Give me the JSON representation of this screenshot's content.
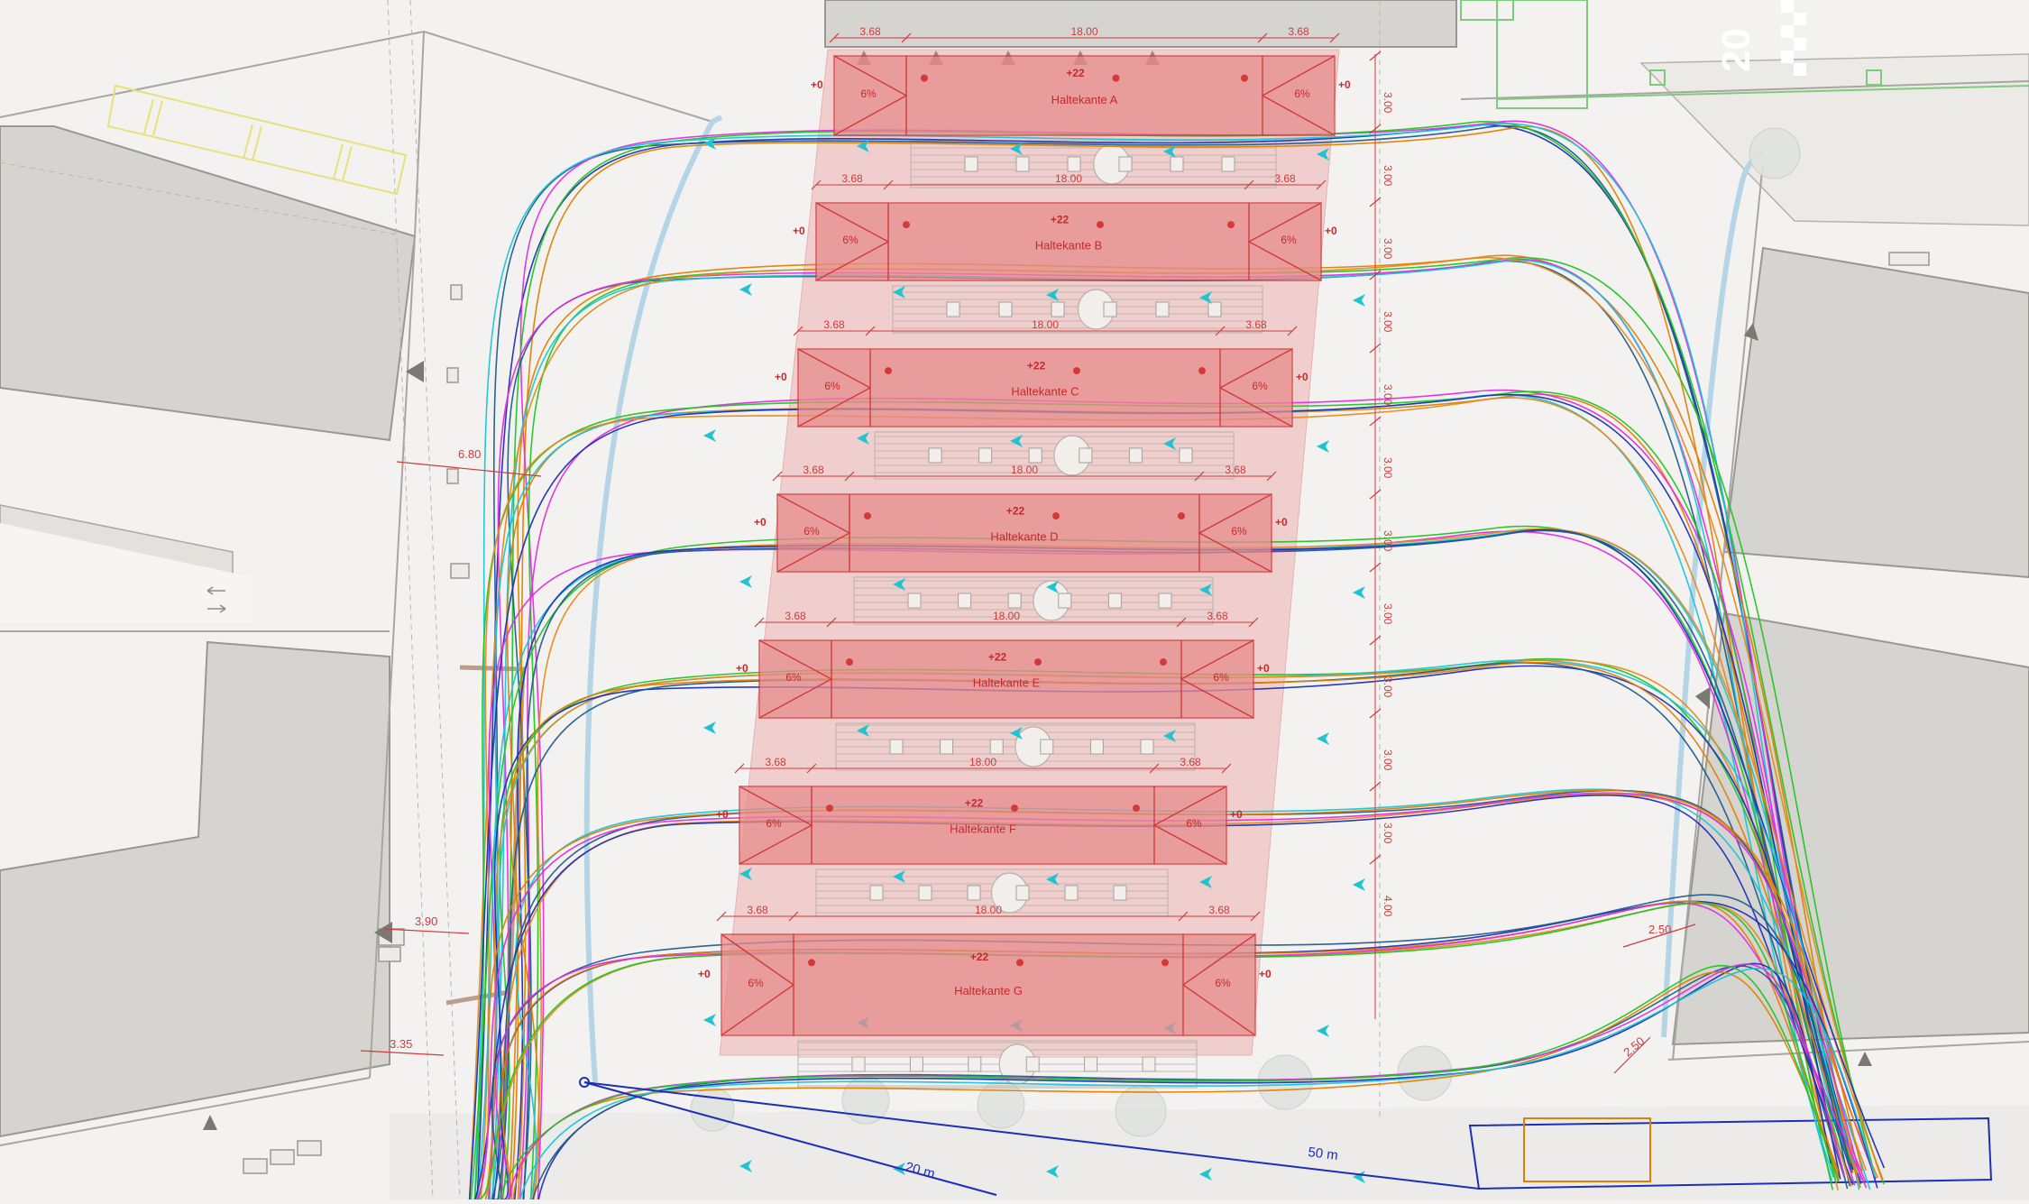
{
  "plan": {
    "platforms": [
      {
        "name": "Haltekante A",
        "height_level": "+22",
        "zero_level": "+0",
        "slope": "6%"
      },
      {
        "name": "Haltekante B",
        "height_level": "+22",
        "zero_level": "+0",
        "slope": "6%"
      },
      {
        "name": "Haltekante C",
        "height_level": "+22",
        "zero_level": "+0",
        "slope": "6%"
      },
      {
        "name": "Haltekante D",
        "height_level": "+22",
        "zero_level": "+0",
        "slope": "6%"
      },
      {
        "name": "Haltekante E",
        "height_level": "+22",
        "zero_level": "+0",
        "slope": "6%"
      },
      {
        "name": "Haltekante F",
        "height_level": "+22",
        "zero_level": "+0",
        "slope": "6%"
      },
      {
        "name": "Haltekante G",
        "height_level": "+22",
        "zero_level": "+0",
        "slope": "6%"
      }
    ],
    "dimensions": {
      "ramp_length": "3.68",
      "platform_length": "18.00",
      "lane_widths": [
        "3.00",
        "3.00",
        "3.00",
        "3.00",
        "3.00",
        "3.00",
        "3.00",
        "3.00",
        "3.00",
        "3.00",
        "3.00",
        "4.00"
      ],
      "left_width_top": "6.80",
      "left_width_mid": "3.90",
      "left_width_bottom": "3.35",
      "right_width_a": "2.50",
      "right_width_b": "2.50",
      "road_marking": "20"
    },
    "scale_labels": {
      "short": "20 m",
      "long": "50 m"
    },
    "colors": {
      "platform_fill": "#e88c8c",
      "platform_stroke": "#d23a3a",
      "dimension": "#d03a3a",
      "arrow": "#1fc4d0",
      "building": "#d6d4d0",
      "tracks": [
        "#1b2fb8",
        "#1f5d8c",
        "#e07f00",
        "#e02ee0",
        "#22c422",
        "#19c4d6",
        "#e58a1a"
      ]
    }
  }
}
